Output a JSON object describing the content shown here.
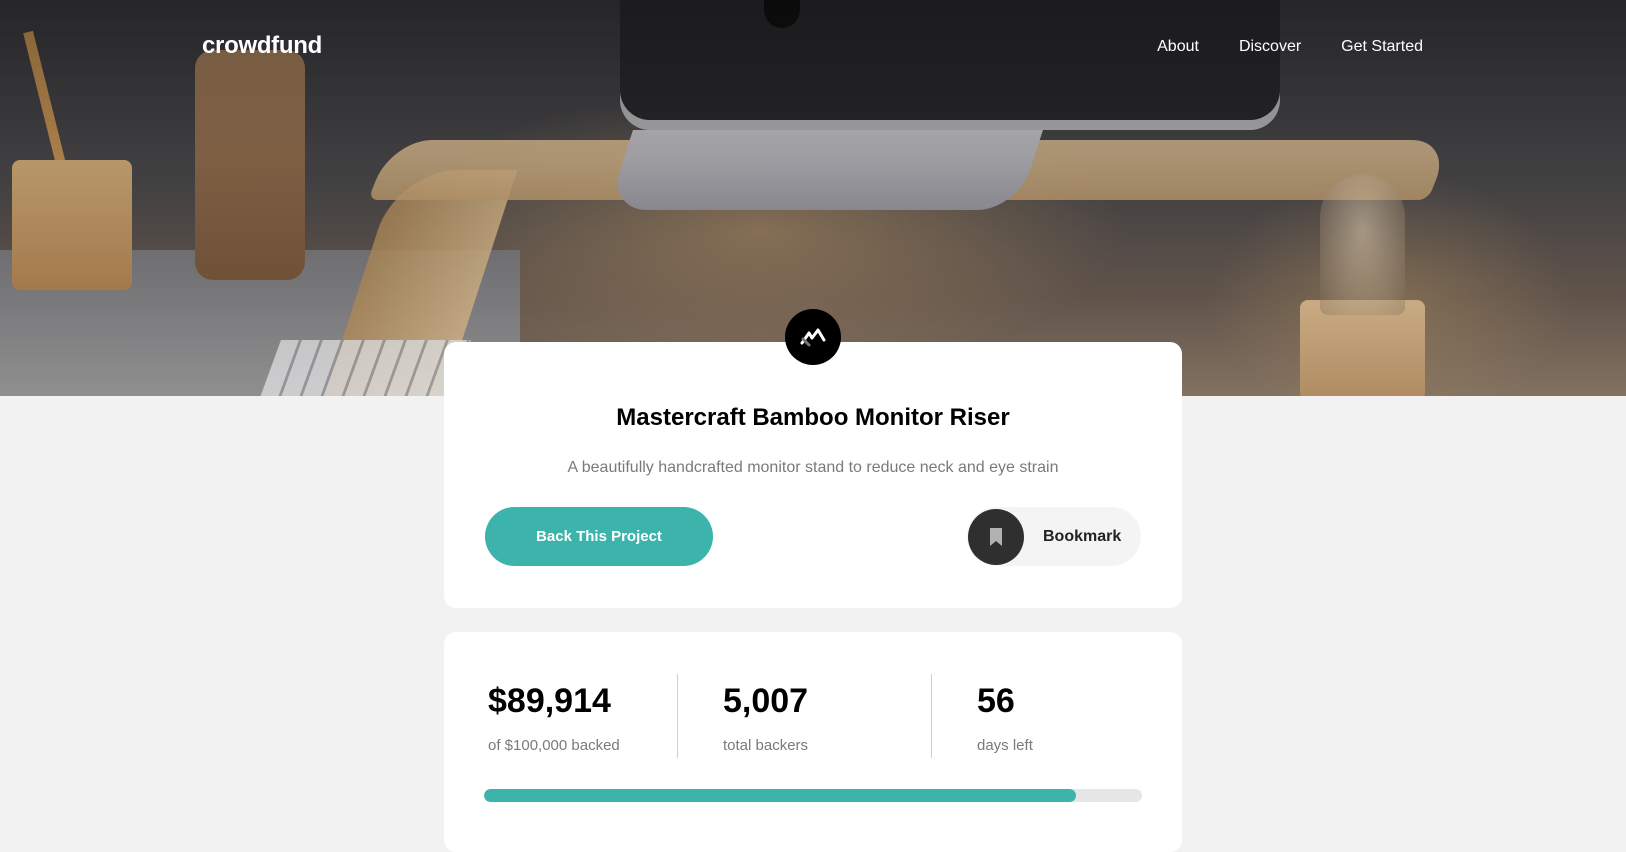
{
  "header": {
    "logo": "crowdfund",
    "nav": [
      {
        "label": "About"
      },
      {
        "label": "Discover"
      },
      {
        "label": "Get Started"
      }
    ]
  },
  "project": {
    "brand_icon": "mastercraft-logo-icon",
    "title": "Mastercraft Bamboo Monitor Riser",
    "subtitle": "A beautifully handcrafted monitor stand to reduce neck and eye strain",
    "back_button_label": "Back This Project",
    "bookmark_label": "Bookmark",
    "bookmark_icon": "bookmark-icon"
  },
  "stats": {
    "backed": {
      "value": "$89,914",
      "label": "of $100,000 backed"
    },
    "backers": {
      "value": "5,007",
      "label": "total backers"
    },
    "days": {
      "value": "56",
      "label": "days left"
    },
    "progress_fraction": 0.899
  },
  "colors": {
    "accent": "#3cb4ab",
    "text_dark": "#000000",
    "text_muted": "#7a7a7a",
    "page_bg": "#f2f2f2"
  }
}
